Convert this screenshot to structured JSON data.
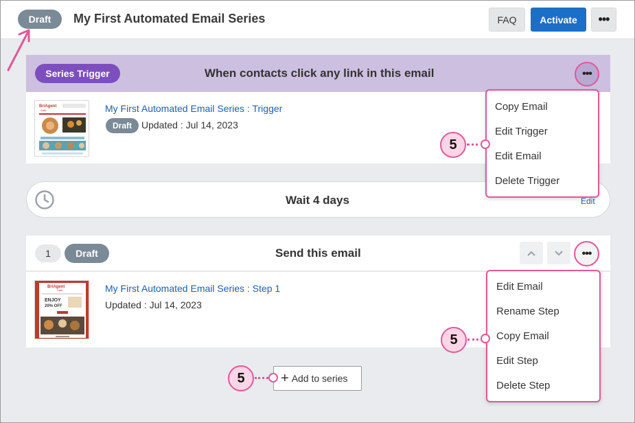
{
  "header": {
    "status": "Draft",
    "title": "My First Automated Email Series",
    "faq_label": "FAQ",
    "activate_label": "Activate",
    "more_label": "•••"
  },
  "trigger": {
    "pill": "Series Trigger",
    "text": "When contacts click any link in this email",
    "more_label": "•••",
    "email_link": "My First Automated Email Series : Trigger",
    "status": "Draft",
    "updated": "Updated : Jul 14, 2023"
  },
  "trigger_menu": {
    "items": [
      "Copy Email",
      "Edit Trigger",
      "Edit Email",
      "Delete Trigger"
    ]
  },
  "wait": {
    "text": "Wait 4 days",
    "edit_label": "Edit"
  },
  "step": {
    "number": "1",
    "status": "Draft",
    "text": "Send this email",
    "more_label": "•••",
    "email_link": "My First Automated Email Series : Step 1",
    "updated": "Updated : Jul 14, 2023"
  },
  "step_menu": {
    "items": [
      "Edit Email",
      "Rename Step",
      "Copy Email",
      "Edit Step",
      "Delete Step"
    ]
  },
  "add_series": {
    "plus": "+",
    "label": "Add to series"
  },
  "callouts": {
    "trigger_menu": "5",
    "step_menu": "5",
    "add_series": "5"
  },
  "thumb_trigger": {
    "brand": "BriAgent",
    "sub": "Cafe"
  },
  "thumb_step": {
    "brand": "BriAgent",
    "sub": "Cafe",
    "line1": "ENJOY",
    "line2": "20% OFF"
  },
  "colors": {
    "accent_pink": "#e0579a",
    "trigger_purple": "#7d4fbe",
    "trigger_bar": "#cdbfe0",
    "activate_blue": "#1a6fc9",
    "draft_gray": "#7a8a96",
    "link_blue": "#1a5fb4"
  }
}
